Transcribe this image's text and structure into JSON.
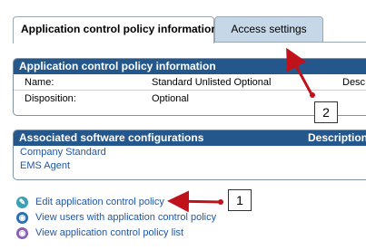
{
  "tabs": [
    {
      "label": "Application control policy information",
      "active": true
    },
    {
      "label": "Access settings",
      "active": false
    }
  ],
  "policy_info": {
    "header": "Application control policy information",
    "rows": [
      {
        "label": "Name:",
        "value": "Standard Unlisted Optional",
        "extra": "Desc"
      },
      {
        "label": "Disposition:",
        "value": "Optional",
        "extra": ""
      }
    ]
  },
  "software": {
    "header": "Associated software configurations",
    "header_col2": "Description",
    "items": [
      "Company Standard",
      "EMS Agent"
    ]
  },
  "links": [
    {
      "label": "Edit application control policy",
      "icon": "edit-icon",
      "color": "#3a9fb5"
    },
    {
      "label": "View users with application control policy",
      "icon": "view-users-icon",
      "color": "#2a6db5"
    },
    {
      "label": "View application control policy list",
      "icon": "view-list-icon",
      "color": "#8a5fb5"
    }
  ],
  "callouts": {
    "one": "1",
    "two": "2"
  },
  "colors": {
    "header_bg": "#24588c",
    "tab_inactive_bg": "#c6d7e7",
    "link": "#1f57a8",
    "arrow": "#c0121b"
  }
}
